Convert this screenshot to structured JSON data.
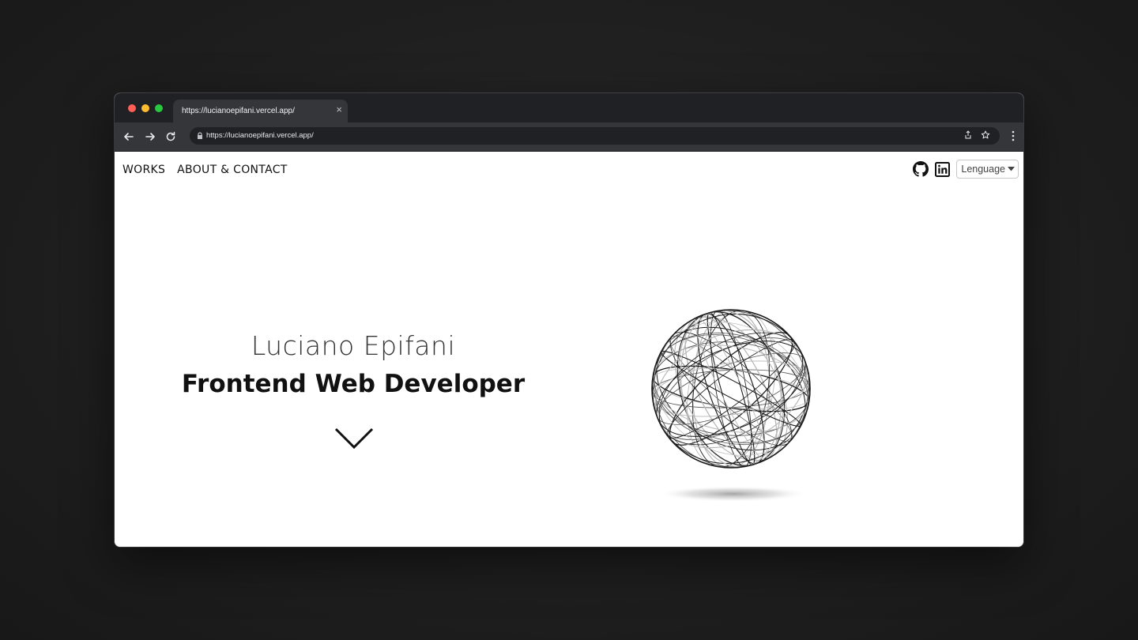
{
  "browser": {
    "tab_title": "https://lucianoepifani.vercel.app/",
    "url": "https://lucianoepifani.vercel.app/",
    "traffic_lights": [
      "#ff5f57",
      "#febc2e",
      "#28c840"
    ]
  },
  "nav": {
    "works": "WORKS",
    "about_contact": "ABOUT & CONTACT"
  },
  "header": {
    "language_label": "Lenguage",
    "icons": [
      "github-icon",
      "linkedin-icon"
    ]
  },
  "hero": {
    "name": "Luciano Epifani",
    "role": "Frontend Web Developer"
  }
}
